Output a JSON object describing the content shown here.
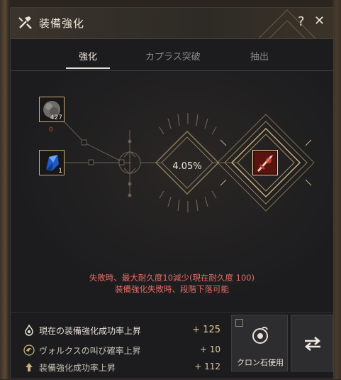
{
  "window": {
    "title": "装備強化",
    "help": "?",
    "close": "✕"
  },
  "tabs": [
    {
      "label": "強化",
      "active": true
    },
    {
      "label": "カプラス突破",
      "active": false
    },
    {
      "label": "抽出",
      "active": false
    }
  ],
  "slots": {
    "material": {
      "count": "427",
      "sub_value": "0",
      "icon": "black-stone-icon"
    },
    "valks": {
      "count": "1",
      "icon": "blue-crystal-icon"
    },
    "target": {
      "icon": "weapon-icon"
    }
  },
  "success_rate": "4.05%",
  "warnings": [
    "失敗時、最大耐久度10減少(現在耐久度 100)",
    "装備強化失敗時、段階下落可能"
  ],
  "stats": [
    {
      "icon": "flame-icon",
      "label": "現在の装備強化成功率上昇",
      "value": "+ 125"
    },
    {
      "icon": "valks-cry-icon",
      "label": "ヴォルクスの叫び確率上昇",
      "value": "+ 10"
    },
    {
      "icon": "arrow-up-icon",
      "label": "装備強化成功率上昇",
      "value": "+ 112"
    }
  ],
  "buttons": {
    "cron_label": "クロン石使用",
    "swap_icon": "swap-icon"
  },
  "colors": {
    "accent": "#c9ad7a",
    "warning": "#e36d63",
    "value": "#d9c9a2",
    "target_glow": "#c0342a"
  }
}
